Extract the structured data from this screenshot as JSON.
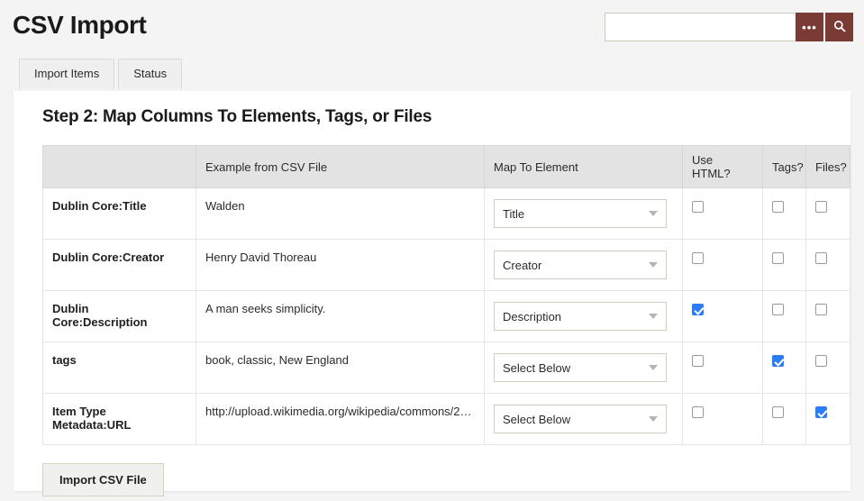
{
  "header": {
    "site_title": "CSV Import",
    "search": {
      "value": "",
      "placeholder": "",
      "advanced_label": "•••",
      "advanced_icon": "ellipsis-icon",
      "submit_icon": "search-icon"
    }
  },
  "tabs": [
    {
      "label": "Import Items",
      "active": true
    },
    {
      "label": "Status",
      "active": false
    }
  ],
  "main": {
    "step_title": "Step 2: Map Columns To Elements, Tags, or Files",
    "table": {
      "headers": [
        "",
        "Example from CSV File",
        "Map To Element",
        "Use HTML?",
        "Tags?",
        "Files?"
      ],
      "rows": [
        {
          "column_name": "Dublin Core:Title",
          "example": "Walden",
          "map_to_element": "Title",
          "use_html": false,
          "tags": false,
          "files": false
        },
        {
          "column_name": "Dublin Core:Creator",
          "example": "Henry David Thoreau",
          "map_to_element": "Creator",
          "use_html": false,
          "tags": false,
          "files": false
        },
        {
          "column_name": "Dublin Core:Description",
          "example": "A man seeks simplicity.",
          "map_to_element": "Description",
          "use_html": true,
          "tags": false,
          "files": false
        },
        {
          "column_name": "tags",
          "example": "book, classic, New England",
          "map_to_element": "Select Below",
          "use_html": false,
          "tags": true,
          "files": false
        },
        {
          "column_name": "Item Type Metadata:URL",
          "example": "http://upload.wikimedia.org/wikipedia/commons/2…",
          "map_to_element": "Select Below",
          "use_html": false,
          "tags": false,
          "files": true
        }
      ]
    },
    "submit_label": "Import CSV File"
  },
  "colors": {
    "accent": "#7a3b35",
    "page_background": "#f4f4f4",
    "panel_background": "#ffffff",
    "table_header_background": "#e3e3e3",
    "checkbox_checked": "#2b7cf7"
  }
}
